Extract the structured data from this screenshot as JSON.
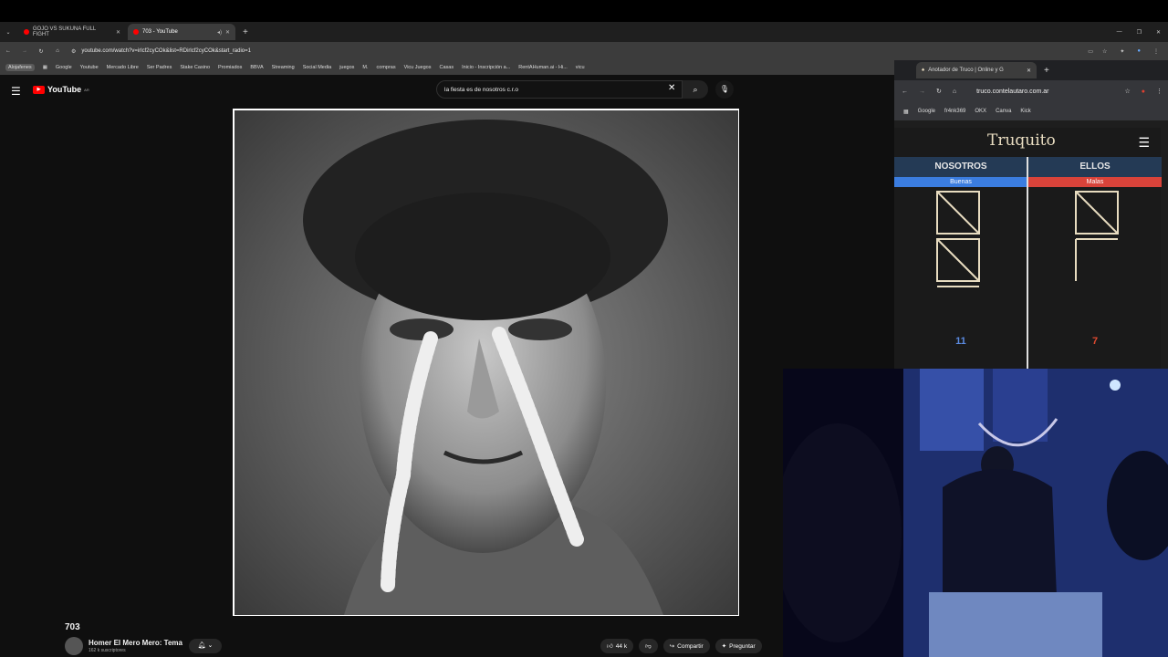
{
  "browser": {
    "tabs": [
      {
        "label": "GOJO VS SUKUNA FULL FIGHT",
        "active": false
      },
      {
        "label": "703 - YouTube",
        "active": true
      }
    ],
    "url": "youtube.com/watch?v=irlcf2cyCOk&list=RDirlcf2cyCOk&start_radio=1",
    "bookmarks": [
      "Alojafenes",
      "Google",
      "Youtube",
      "Mercado Libre",
      "Ser Padres",
      "Stake Casino",
      "Promiados",
      "BBVA",
      "Streaming",
      "Social Media",
      "juegos",
      "M.",
      "compras",
      "Vicu Juegos",
      "Casas",
      "Inicio - Inscripción a...",
      "RentAHuman.ai - Hi...",
      "vicu"
    ]
  },
  "youtube": {
    "logo": "YouTube",
    "region": "AR",
    "search_value": "la fiesta es de nosotros c.r.o",
    "video_title": "703",
    "channel_name": "Homer El Mero Mero: Tema",
    "channel_subs": "162 k suscriptores",
    "likes": "44 k",
    "share_label": "Compartir",
    "ask_label": "Preguntar"
  },
  "truco_window": {
    "tab_label": "Anotador de Truco | Online y G",
    "url": "truco.contelautaro.com.ar",
    "bookmarks": [
      "Google",
      "fr4nk369",
      "OKX",
      "Canva",
      "Kick"
    ],
    "app_title": "Truquito",
    "teams": [
      {
        "name": "NOSOTROS",
        "status": "Buenas",
        "status_color": "#3b7de0",
        "score": "11",
        "score_color": "#5a8ae0"
      },
      {
        "name": "ELLOS",
        "status": "Malas",
        "status_color": "#d9433a",
        "score": "7",
        "score_color": "#e04a30"
      }
    ]
  },
  "colors": {
    "accent_red": "#ff0000",
    "truco_line": "#e8dcc0"
  }
}
